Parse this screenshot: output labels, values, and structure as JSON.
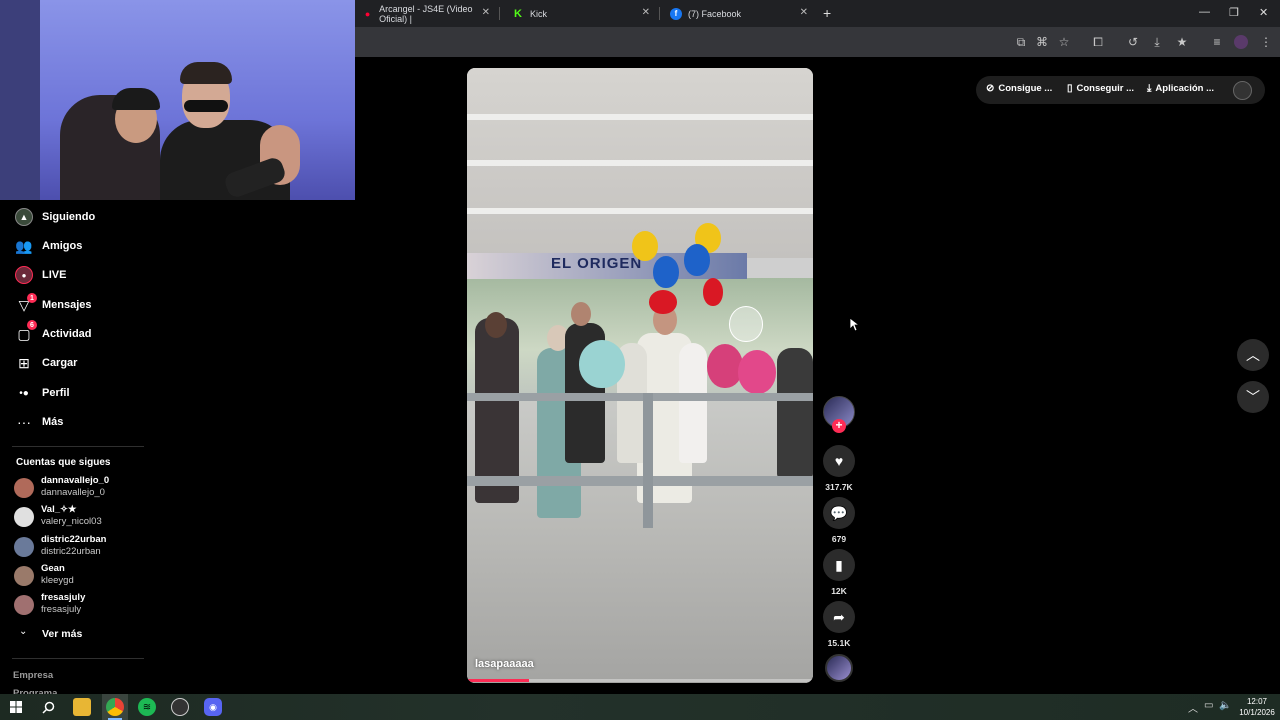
{
  "browser": {
    "tabs": [
      {
        "title": "Arcangel - JS4E (Video Oficial) |",
        "icon": "youtube-icon",
        "color": "#ff0033"
      },
      {
        "title": "Kick",
        "icon": "kick-icon",
        "color": "#53fc18"
      },
      {
        "title": "(7) Facebook",
        "icon": "facebook-icon",
        "color": "#1877f2"
      }
    ],
    "new_tab_glyph": "+"
  },
  "sidebar": {
    "items": [
      {
        "label": "Siguiendo",
        "icon": "following-icon"
      },
      {
        "label": "Amigos",
        "icon": "friends-icon"
      },
      {
        "label": "LIVE",
        "icon": "live-icon"
      },
      {
        "label": "Mensajes",
        "icon": "messages-icon",
        "badge": "1"
      },
      {
        "label": "Actividad",
        "icon": "activity-icon",
        "badge": "6"
      },
      {
        "label": "Cargar",
        "icon": "upload-icon"
      },
      {
        "label": "Perfil",
        "icon": "profile-icon"
      },
      {
        "label": "Más",
        "icon": "more-icon"
      }
    ],
    "following_title": "Cuentas que sigues",
    "accounts": [
      {
        "name": "dannavallejo_0",
        "handle": "dannavallejo_0",
        "avatar_color": "#b06a5a"
      },
      {
        "name": "Val_✧★",
        "handle": "valery_nicol03",
        "avatar_color": "#e0e0e0"
      },
      {
        "name": "distric22urban",
        "handle": "distric22urban",
        "avatar_color": "#6a7a9a"
      },
      {
        "name": "Gean",
        "handle": "kleeygd",
        "avatar_color": "#9a7a6a"
      },
      {
        "name": "fresasjuly",
        "handle": "fresasjuly",
        "avatar_color": "#a07070"
      }
    ],
    "see_more": "Ver más",
    "footer": [
      "Empresa",
      "Programa"
    ]
  },
  "video": {
    "caption": "lasapaaaaa",
    "banner_text": "EL ORIGEN",
    "progress": 0.18
  },
  "actions": {
    "likes": "317.7K",
    "comments": "679",
    "saves": "12K",
    "shares": "15.1K"
  },
  "top_actions": {
    "coins_label": "Consigue ...",
    "get_label": "Conseguir ...",
    "app_label": "Aplicación ..."
  },
  "taskbar": {
    "time": "12:07",
    "date": "10/1/2026"
  },
  "colors": {
    "accent": "#fe2c55",
    "background": "#000000"
  }
}
